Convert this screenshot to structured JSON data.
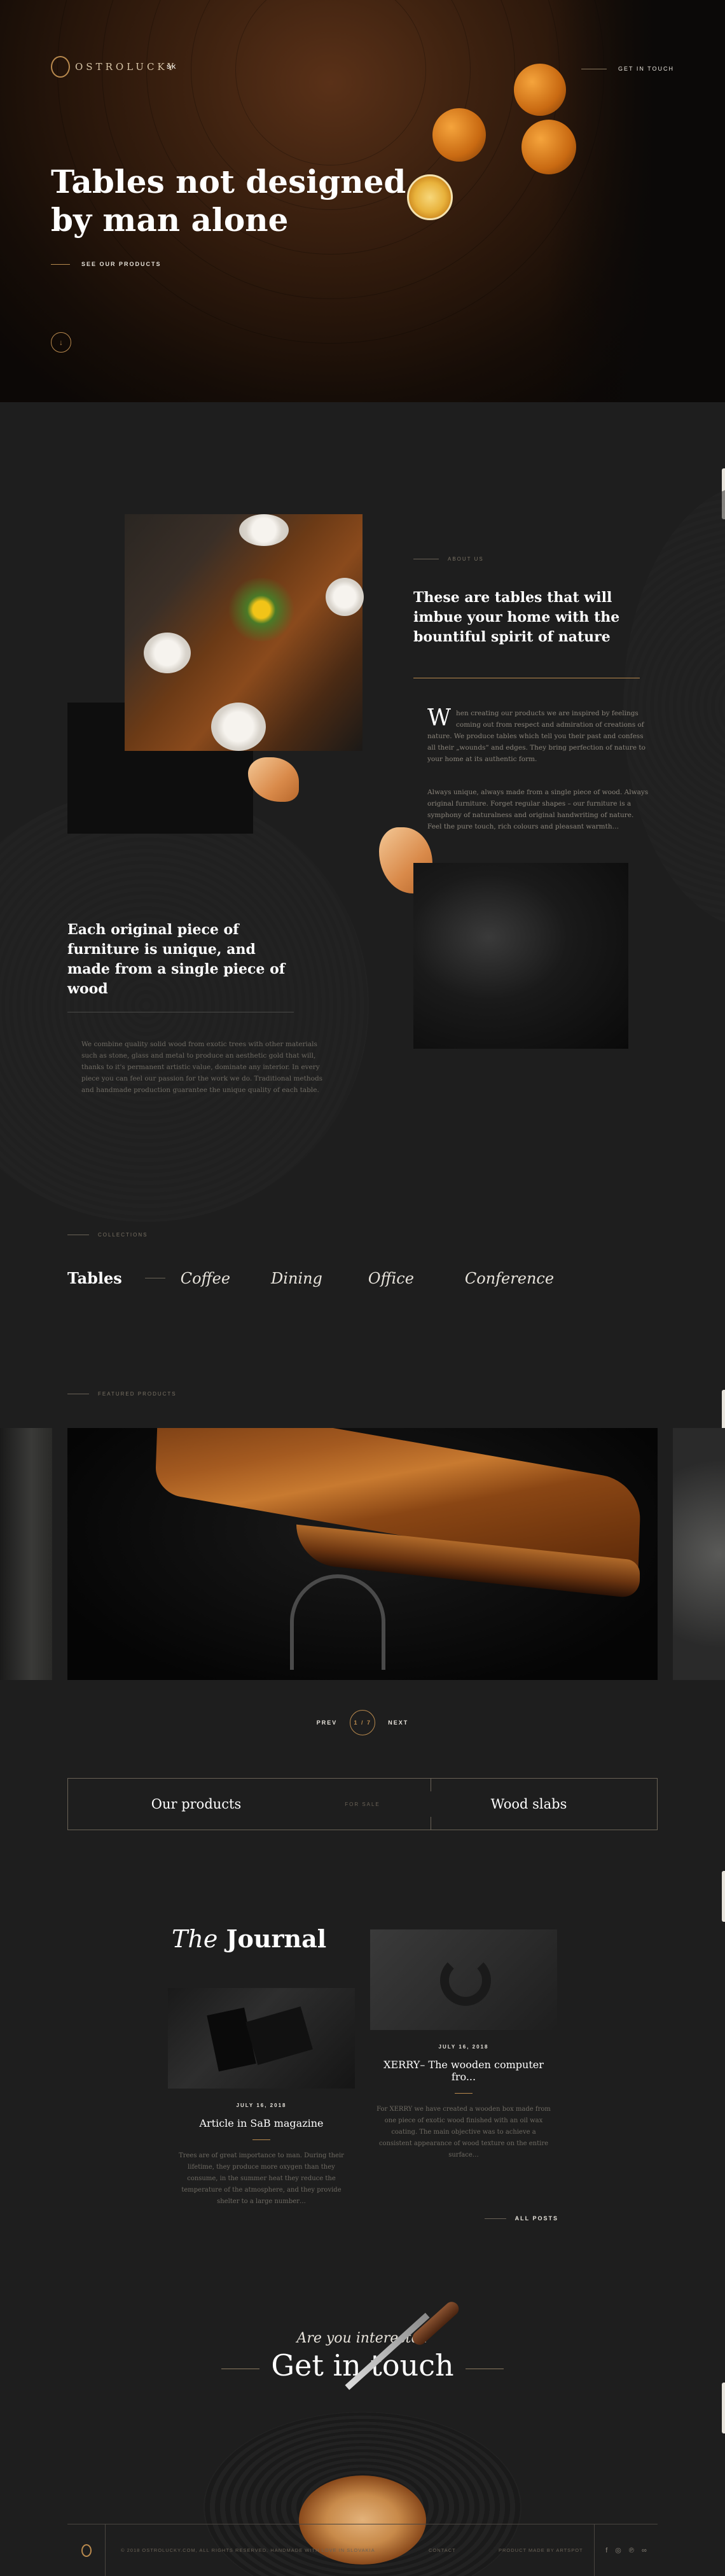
{
  "header": {
    "logo_text": "OSTROLUCKY",
    "lang": "SK",
    "get_in_touch": "GET IN TOUCH"
  },
  "hero": {
    "title_line1": "Tables not designed",
    "title_line2": "by man alone",
    "cta": "SEE OUR PRODUCTS",
    "scroll_icon": "arrow-down-icon"
  },
  "about": {
    "eyebrow": "ABOUT US",
    "heading": "These are tables that will imbue your home with the bountiful spirit of nature",
    "dropcap": "W",
    "paragraph1": "hen creating our products we are inspired by feelings coming out from respect and admiration of creations of nature. We produce tables which tell you their past and confess all their „wounds“ and edges. They bring perfection of nature to your home at its authentic form.",
    "paragraph2": "Always unique, always made from a single piece of wood. Always original furniture. Forget regular shapes – our furniture is a symphony of naturalness and original handwriting of nature. Feel the pure touch, rich colours and pleasant warmth…",
    "unique_heading": "Each original piece of furniture is unique, and made from a single piece of wood",
    "unique_paragraph": "We combine quality solid wood from exotic trees with other materials such as stone, glass and metal to produce an aesthetic gold that will, thanks to it's permanent artistic value, dominate any interior. In every piece you can feel our passion for the work we do. Traditional methods and handmade production guarantee the unique quality of each table."
  },
  "collections": {
    "eyebrow": "COLLECTIONS",
    "items": [
      "Tables",
      "Coffee",
      "Dining",
      "Office",
      "Conference"
    ],
    "active_index": 0
  },
  "featured": {
    "eyebrow": "FEATURED PRODUCTS",
    "prev": "PREV",
    "next": "NEXT",
    "counter": "1 / 7"
  },
  "products_box": {
    "left": "Our products",
    "middle": "FOR SALE",
    "right": "Wood slabs"
  },
  "journal": {
    "title_italic": "The",
    "title_bold": "Journal",
    "posts": [
      {
        "date": "JULY 16, 2018",
        "title": "Article in SaB magazine",
        "excerpt": "Trees are of great importance to man. During their lifetime, they produce more oxygen than they consume, in the summer heat they reduce the temperature of the atmosphere, and they provide shelter to a large number…"
      },
      {
        "date": "JULY 16, 2018",
        "title": "XERRY– The wooden computer fro...",
        "excerpt": "For XERRY we have created a wooden box made from one piece of exotic wood finished with an oil wax coating. The main objective was to achieve a consistent appearance of wood texture on the entire surface…"
      }
    ],
    "all_posts": "ALL POSTS"
  },
  "contact": {
    "subtitle": "Are you interested",
    "title": "Get in touch"
  },
  "footer": {
    "copyright": "© 2018 OSTROLUCKY.COM, ALL RIGHTS RESERVED. HANDMADE WITH LOVE IN SLOVAKIA",
    "contact": "CONTACT",
    "credit": "PRODUCT MADE BY ARTSPOT",
    "social": [
      "facebook-icon",
      "instagram-icon",
      "pinterest-icon",
      "link-icon"
    ]
  },
  "colors": {
    "accent": "#b98a4e",
    "background": "#1e1e1e",
    "text": "#e8e4dc"
  }
}
